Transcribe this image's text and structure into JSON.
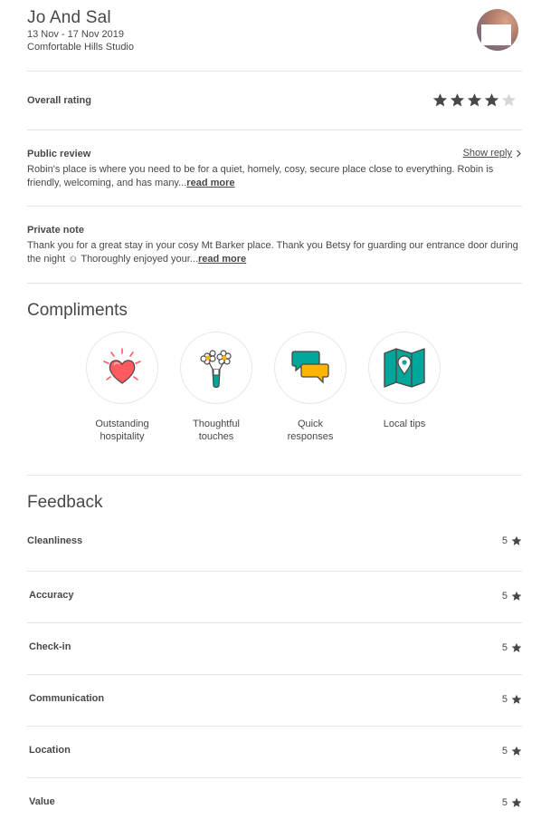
{
  "header": {
    "guest_name": "Jo  And Sal",
    "dates": "13 Nov - 17 Nov 2019",
    "listing": "Comfortable Hills Studio"
  },
  "rating": {
    "label": "Overall rating",
    "stars_filled": 4,
    "stars_total": 5,
    "star_color": "#484848",
    "star_empty_color": "#d8d8d8"
  },
  "public_review": {
    "label": "Public review",
    "show_reply": "Show reply",
    "text": "Robin's place is where you need to be for a quiet, homely, cosy, secure place close to everything. Robin is friendly, welcoming, and has many...",
    "read_more": "read more"
  },
  "private_note": {
    "label": "Private note",
    "text": "Thank you for a great stay in your cosy Mt Barker place. Thank you Betsy for guarding our entrance door during the night ☺ Thoroughly enjoyed your...",
    "read_more": "read more"
  },
  "compliments": {
    "heading": "Compliments",
    "items": [
      {
        "line1": "Outstanding",
        "line2": "hospitality",
        "icon": "heart-icon"
      },
      {
        "line1": "Thoughtful",
        "line2": "touches",
        "icon": "flowers-icon"
      },
      {
        "line1": "Quick",
        "line2": "responses",
        "icon": "chat-bubbles-icon"
      },
      {
        "line1": "Local tips",
        "line2": "",
        "icon": "map-pin-icon"
      }
    ]
  },
  "feedback": {
    "heading": "Feedback",
    "rows": [
      {
        "label": "Cleanliness",
        "score": "5"
      },
      {
        "label": "Accuracy",
        "score": "5"
      },
      {
        "label": "Check-in",
        "score": "5"
      },
      {
        "label": "Communication",
        "score": "5"
      },
      {
        "label": "Location",
        "score": "5"
      },
      {
        "label": "Value",
        "score": "5"
      }
    ]
  },
  "colors": {
    "text": "#484848",
    "teal": "#00a699",
    "heart_red": "#ff5a5f",
    "yellow": "#ffb400"
  }
}
